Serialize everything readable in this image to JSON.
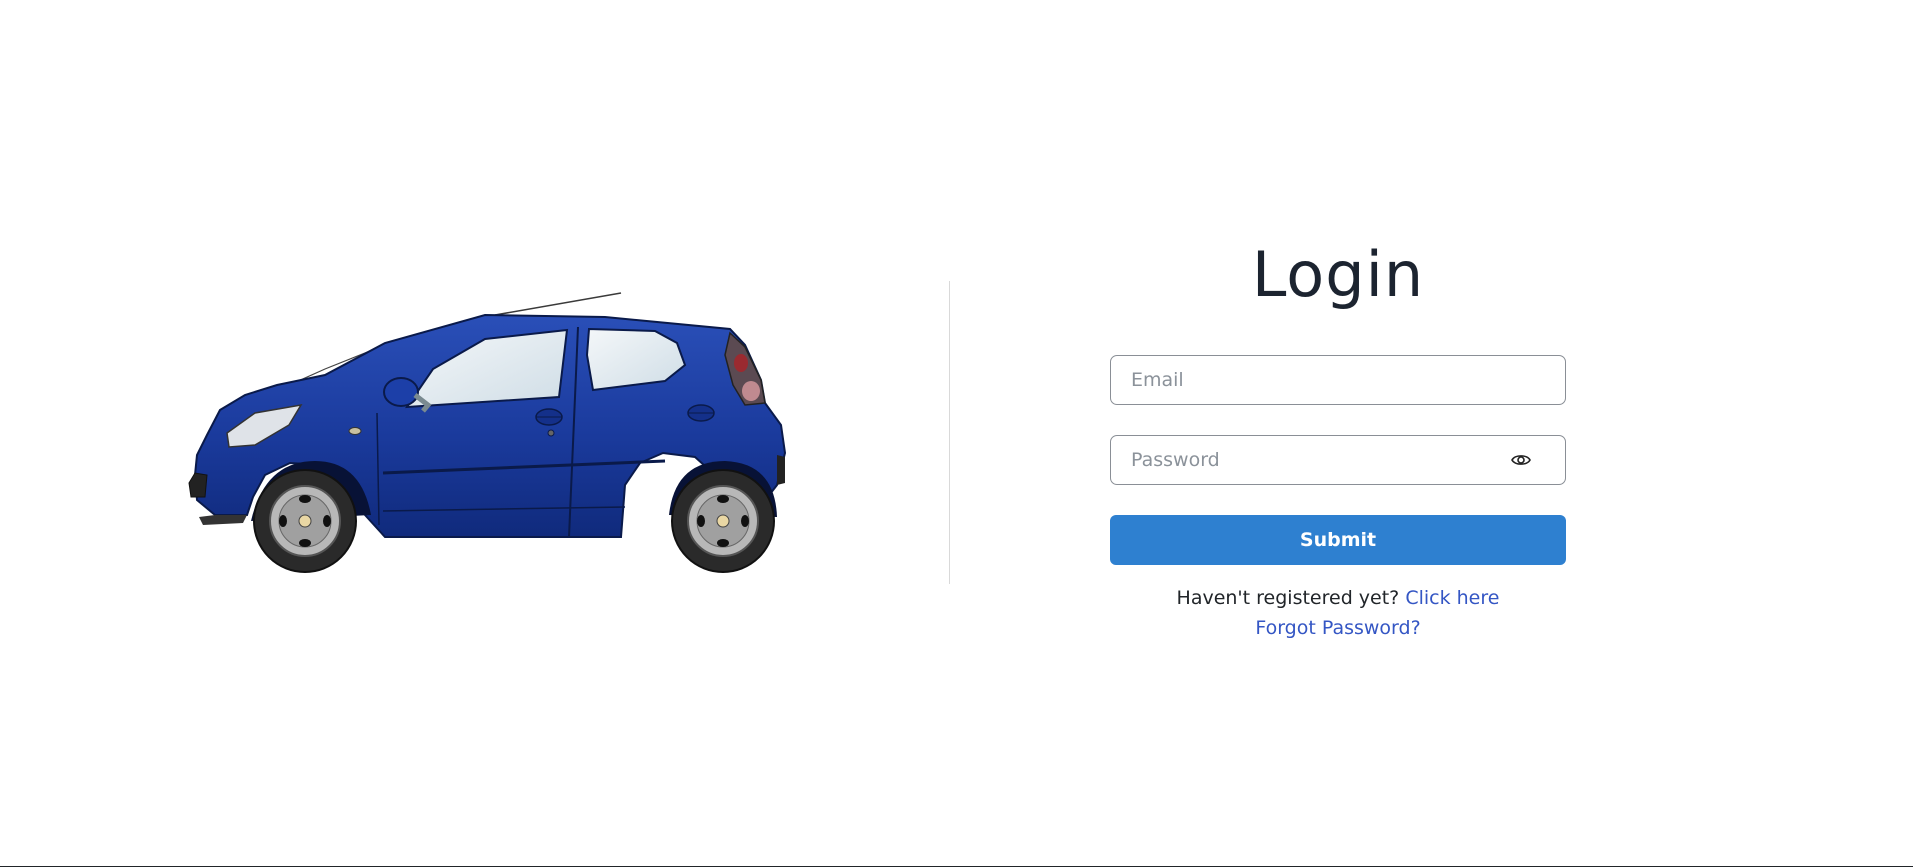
{
  "login": {
    "title": "Login",
    "email_placeholder": "Email",
    "password_placeholder": "Password",
    "submit_label": "Submit",
    "register_prompt": "Haven't registered yet?",
    "register_link": "Click here",
    "forgot_link": "Forgot Password?"
  },
  "icons": {
    "password_toggle": "eye-icon",
    "hero": "car-illustration"
  },
  "colors": {
    "primary_button": "#2e80d0",
    "link": "#3456c4",
    "car_body": "#1a3fa0",
    "title_text": "#1c2430"
  }
}
